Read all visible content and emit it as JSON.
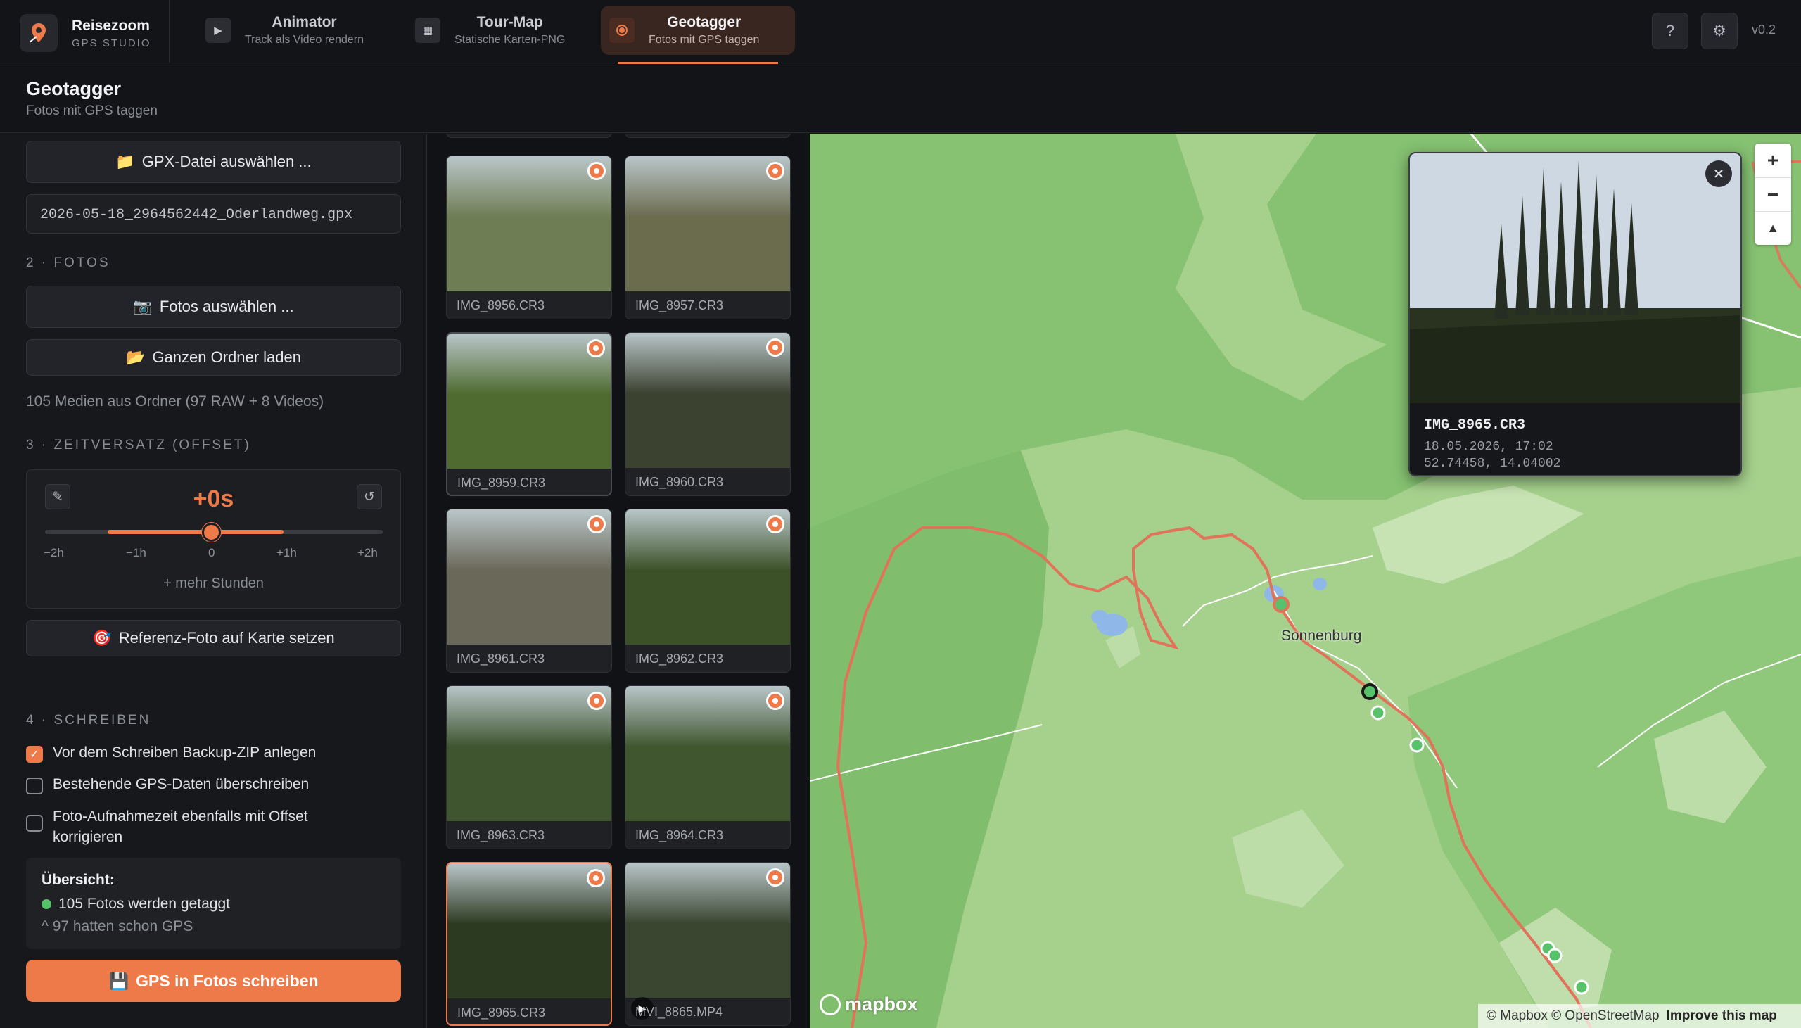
{
  "app": {
    "name": "Reisezoom",
    "subtitle": "GPS STUDIO",
    "version": "v0.2"
  },
  "tabs": [
    {
      "label": "Animator",
      "sub": "Track als Video rendern",
      "icon": "play-icon"
    },
    {
      "label": "Tour-Map",
      "sub": "Statische Karten-PNG",
      "icon": "map-icon"
    },
    {
      "label": "Geotagger",
      "sub": "Fotos mit GPS taggen",
      "icon": "pin-icon",
      "active": true
    }
  ],
  "toolbar": {
    "help": "?",
    "settings": "⚙"
  },
  "page": {
    "title": "Geotagger",
    "subtitle": "Fotos mit GPS taggen"
  },
  "sidebar": {
    "gpx_button": "GPX-Datei auswählen ...",
    "gpx_file": "2026-05-18_2964562442_Oderlandweg.gpx",
    "section2": "2 · FOTOS",
    "photos_button": "Fotos auswählen ...",
    "folder_button": "Ganzen Ordner laden",
    "media_note": "105 Medien aus Ordner (97 RAW + 8 Videos)",
    "section3": "3 · ZEITVERSATZ (OFFSET)",
    "offset_value": "+0s",
    "offset_level": 0,
    "ticks": [
      "−2h",
      "−1h",
      "0",
      "+1h",
      "+2h"
    ],
    "more_hours": "+ mehr Stunden",
    "ref_button": "Referenz-Foto auf Karte setzen",
    "section4": "4 · SCHREIBEN",
    "checks": [
      {
        "label": "Vor dem Schreiben Backup-ZIP anlegen",
        "checked": true
      },
      {
        "label": "Bestehende GPS-Daten überschreiben",
        "checked": false
      },
      {
        "label": "Foto-Aufnahmezeit ebenfalls mit Offset korrigieren",
        "checked": false
      }
    ],
    "summary_title": "Übersicht:",
    "summary_tagged": "105 Fotos werden getaggt",
    "summary_gps": "^ 97 hatten schon GPS",
    "write_button": "GPS in Fotos schreiben"
  },
  "photos": [
    {
      "name": "IMG_8956.CR3",
      "tint": "#6f7d55"
    },
    {
      "name": "IMG_8957.CR3",
      "tint": "#6b6b4e"
    },
    {
      "name": "IMG_8959.CR3",
      "tint": "#4f6b2f",
      "highlight": true
    },
    {
      "name": "IMG_8960.CR3",
      "tint": "#3c4230"
    },
    {
      "name": "IMG_8961.CR3",
      "tint": "#6a6859"
    },
    {
      "name": "IMG_8962.CR3",
      "tint": "#3c5128"
    },
    {
      "name": "IMG_8963.CR3",
      "tint": "#3f5530"
    },
    {
      "name": "IMG_8964.CR3",
      "tint": "#40562f"
    },
    {
      "name": "IMG_8965.CR3",
      "tint": "#2d3a22",
      "selected": true
    },
    {
      "name": "MVI_8865.MP4",
      "tint": "#3a4630",
      "video": true
    }
  ],
  "map": {
    "town": "Sonnenburg",
    "popup": {
      "name": "IMG_8965.CR3",
      "date": "18.05.2026, 17:02",
      "coords": "52.74458, 14.04002"
    },
    "attribution": "© Mapbox © OpenStreetMap",
    "improve": "Improve this map",
    "logo": "mapbox",
    "colors": {
      "land": "#a6d18d",
      "forest": "#7cbc6c",
      "track": "#e0735a",
      "water": "#8fb8e8"
    }
  }
}
